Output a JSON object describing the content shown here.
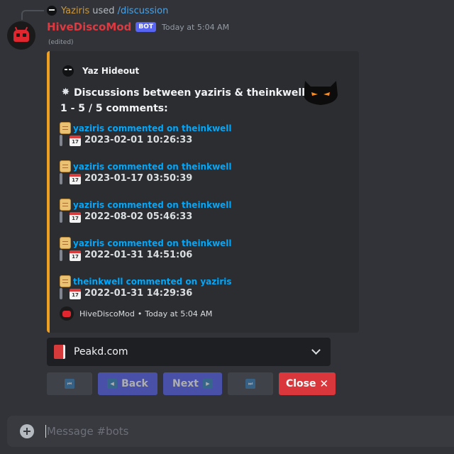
{
  "command": {
    "user": "Yaziris",
    "used_text": "used",
    "command_name": "/discussion"
  },
  "message": {
    "author": "HiveDiscoMod",
    "bot_tag": "BOT",
    "timestamp": "Today at 5:04 AM",
    "edited": "(edited)"
  },
  "embed": {
    "accent_color": "#f0a020",
    "author": "Yaz Hideout",
    "title_icon": "collision-burst-icon",
    "title": "Discussions between yaziris & theinkwell",
    "subtitle": "1 - 5 / 5 comments:",
    "items": [
      {
        "link": "yaziris commented on theinkwell",
        "date": "2023-02-01 10:26:33"
      },
      {
        "link": "yaziris commented on theinkwell",
        "date": "2023-01-17 03:50:39"
      },
      {
        "link": "yaziris commented on theinkwell",
        "date": "2022-08-02 05:46:33"
      },
      {
        "link": "yaziris commented on theinkwell",
        "date": "2022-01-31 14:51:06"
      },
      {
        "link": "theinkwell commented on yaziris",
        "date": "2022-01-31 14:29:36"
      }
    ],
    "calendar_day": "17",
    "footer": {
      "name": "HiveDiscoMod",
      "separator": "•",
      "time": "Today at 5:04 AM"
    }
  },
  "select_menu": {
    "icon": "red-book-icon",
    "label": "Peakd.com"
  },
  "buttons": {
    "first_icon": "first-page-icon",
    "back_label": "Back",
    "next_label": "Next",
    "last_icon": "last-page-icon",
    "close_label": "Close",
    "close_icon": "✕"
  },
  "composer": {
    "placeholder": "Message #bots"
  },
  "colors": {
    "background": "#313338",
    "author_red": "#e0383f",
    "link_blue": "#00a8fc",
    "blurple": "#5865f2",
    "danger": "#da373c"
  }
}
